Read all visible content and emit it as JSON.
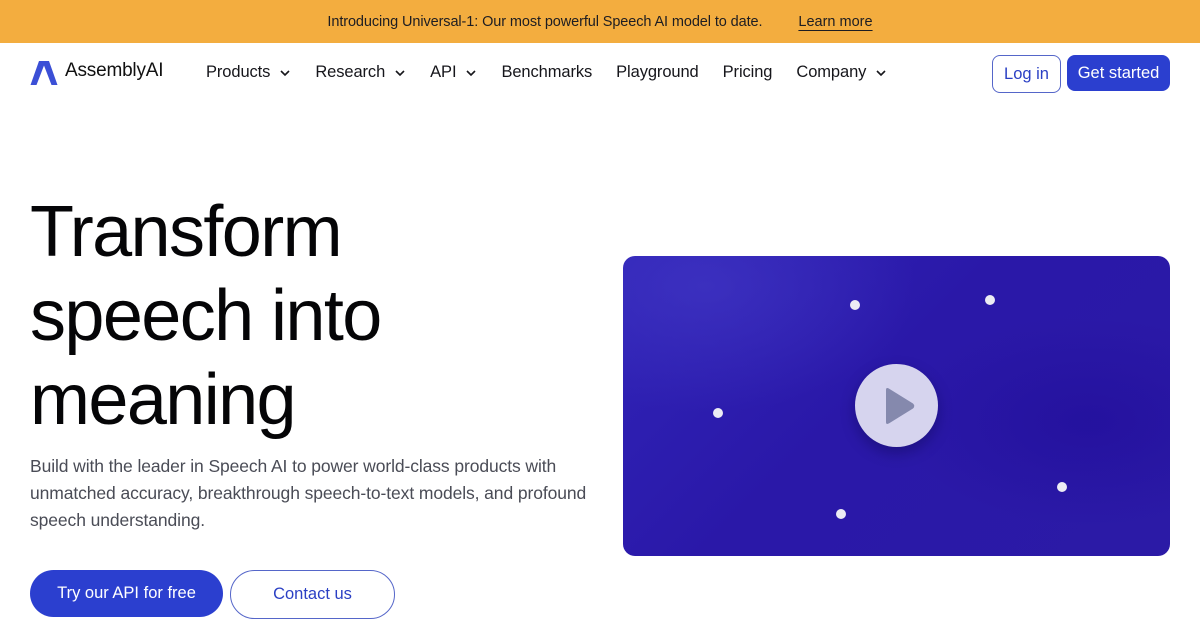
{
  "banner": {
    "message": "Introducing Universal-1: Our most powerful Speech AI model to date.",
    "link_label": "Learn more"
  },
  "brand": {
    "name": "AssemblyAI",
    "logo_icon": "assemblyai-logo-icon",
    "logo_color": "#3b4fd6"
  },
  "nav": {
    "items": [
      {
        "label": "Products",
        "has_dropdown": true
      },
      {
        "label": "Research",
        "has_dropdown": true
      },
      {
        "label": "API",
        "has_dropdown": true
      },
      {
        "label": "Benchmarks",
        "has_dropdown": false
      },
      {
        "label": "Playground",
        "has_dropdown": false
      },
      {
        "label": "Pricing",
        "has_dropdown": false
      },
      {
        "label": "Company",
        "has_dropdown": true
      }
    ],
    "login_label": "Log in",
    "get_started_label": "Get started"
  },
  "hero": {
    "title_lines": [
      "Transform",
      "speech into",
      "meaning"
    ],
    "subtitle": "Build with the leader in Speech AI to power world-class products with unmatched accuracy, breakthrough speech-to-text models, and profound speech understanding.",
    "primary_cta": "Try our API for free",
    "secondary_cta": "Contact us"
  },
  "video": {
    "play_icon": "play-icon"
  },
  "colors": {
    "banner_bg": "#f3ad3f",
    "accent": "#2b3fcf",
    "video_bg": "#2a18a8"
  }
}
